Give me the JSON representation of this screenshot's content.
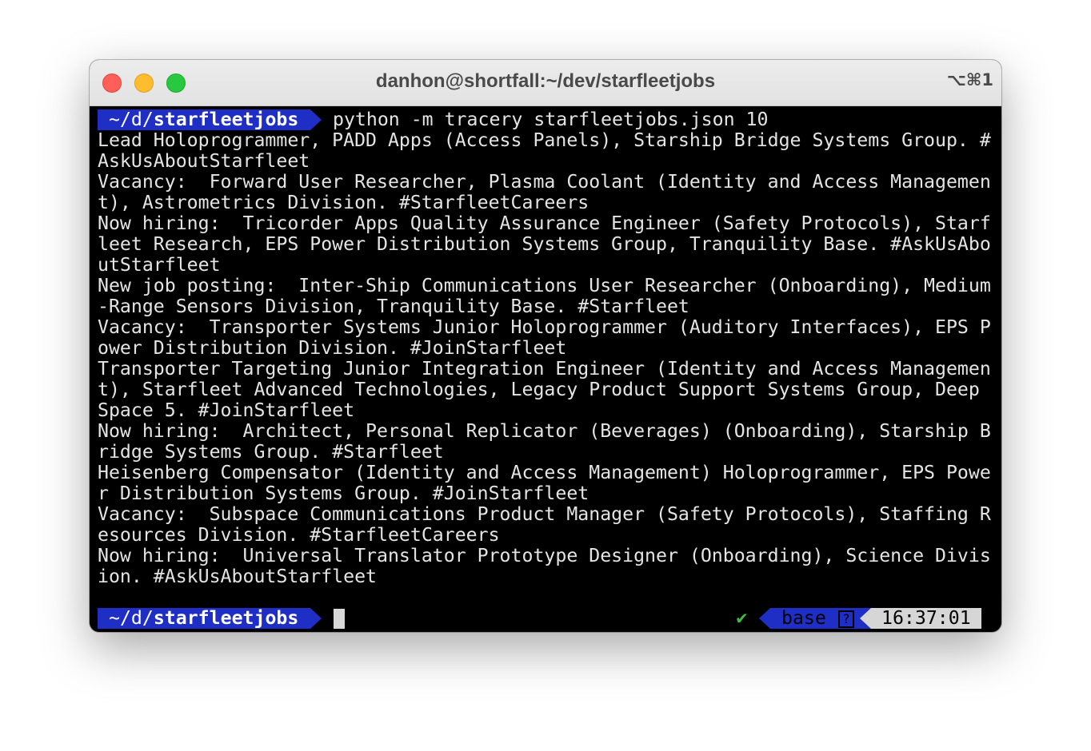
{
  "window": {
    "title": "danhon@shortfall:~/dev/starfleetjobs",
    "shortcut": "⌥⌘1"
  },
  "prompt": {
    "path_prefix": "~/d/",
    "path_dir": "starfleetjobs",
    "command": "python -m tracery starfleetjobs.json 10"
  },
  "output_lines": [
    "Lead Holoprogrammer, PADD Apps (Access Panels), Starship Bridge Systems Group. #",
    "AskUsAboutStarfleet",
    "Vacancy:  Forward User Researcher, Plasma Coolant (Identity and Access Managemen",
    "t), Astrometrics Division. #StarfleetCareers",
    "Now hiring:  Tricorder Apps Quality Assurance Engineer (Safety Protocols), Starf",
    "leet Research, EPS Power Distribution Systems Group, Tranquility Base. #AskUsAbo",
    "utStarfleet",
    "New job posting:  Inter-Ship Communications User Researcher (Onboarding), Medium",
    "-Range Sensors Division, Tranquility Base. #Starfleet",
    "Vacancy:  Transporter Systems Junior Holoprogrammer (Auditory Interfaces), EPS P",
    "ower Distribution Division. #JoinStarfleet",
    "Transporter Targeting Junior Integration Engineer (Identity and Access Managemen",
    "t), Starfleet Advanced Technologies, Legacy Product Support Systems Group, Deep",
    "Space 5. #JoinStarfleet",
    "Now hiring:  Architect, Personal Replicator (Beverages) (Onboarding), Starship B",
    "ridge Systems Group. #Starfleet",
    "Heisenberg Compensator (Identity and Access Management) Holoprogrammer, EPS Powe",
    "r Distribution Systems Group. #JoinStarfleet",
    "Vacancy:  Subspace Communications Product Manager (Safety Protocols), Staffing R",
    "esources Division. #StarfleetCareers",
    "Now hiring:  Universal Translator Prototype Designer (Onboarding), Science Divis",
    "ion. #AskUsAboutStarfleet"
  ],
  "status": {
    "check": "✔",
    "env": "base",
    "env_icon": "?",
    "time": "16:37:01"
  },
  "colors": {
    "prompt_bg": "#1f2ec4",
    "time_bg": "#d6d6d6",
    "check": "#3fbf3f",
    "terminal_bg": "#000000"
  }
}
